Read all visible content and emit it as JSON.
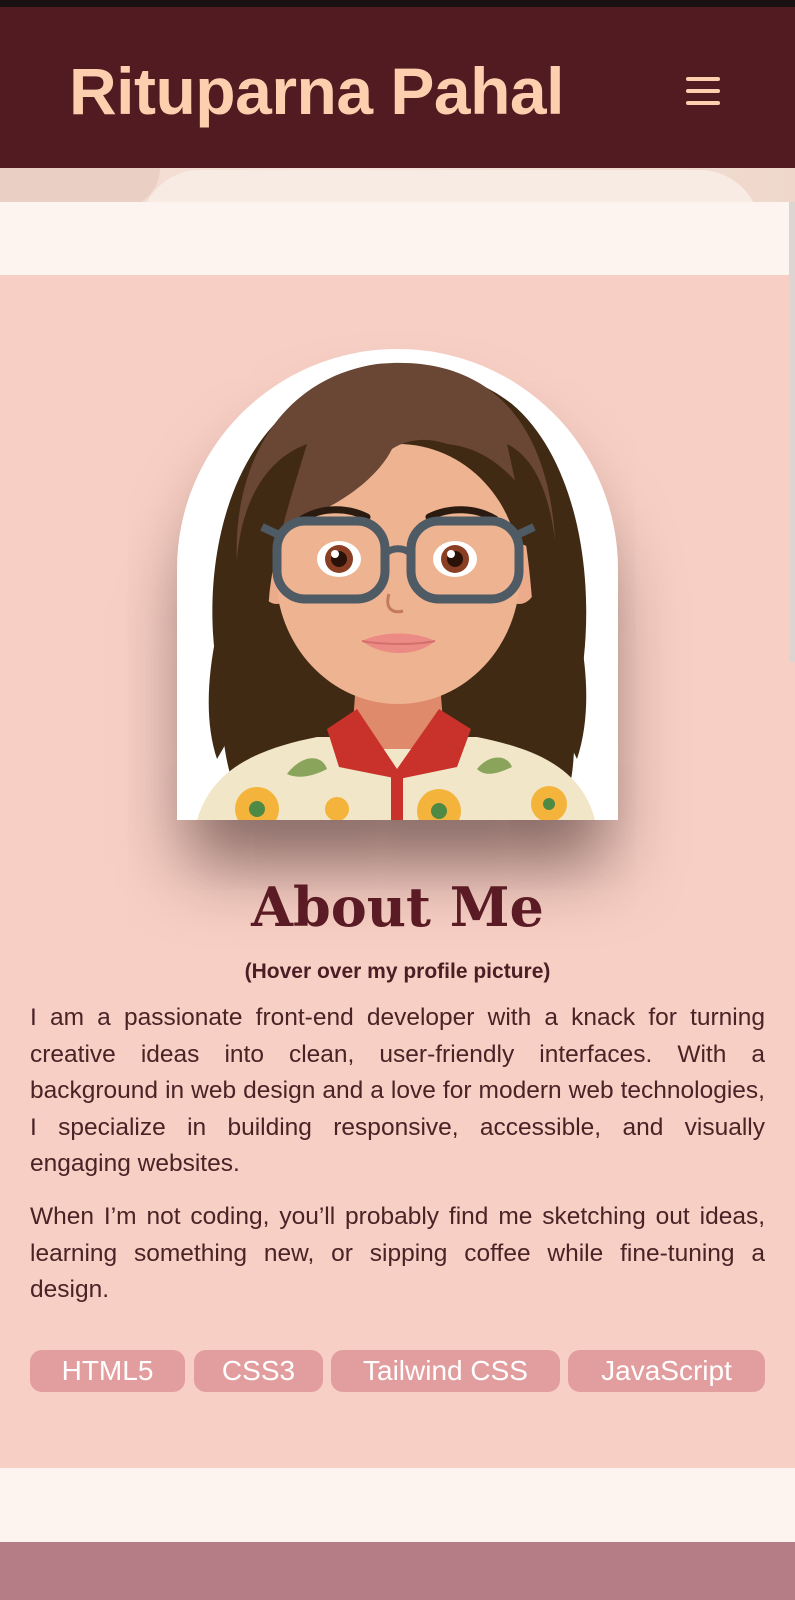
{
  "header": {
    "site_title": "Rituparna Pahal",
    "menu_icon": "hamburger-menu-icon",
    "background_color": "#521b21",
    "title_color": "#fdcfae"
  },
  "about": {
    "profile_image": "cartoon-avatar-woman-with-glasses",
    "title": "About Me",
    "hint": "(Hover over my profile picture)",
    "paragraphs": [
      "I am a passionate front-end developer with a knack for turning creative ideas into clean, user-friendly interfaces. With a background in web design and a love for modern web technologies, I specialize in building responsive, accessible, and visually engaging websites.",
      "When I’m not coding, you’ll probably find me sketching out ideas, learning something new, or sipping coffee while fine-tuning a design."
    ],
    "skills": [
      "HTML5",
      "CSS3",
      "Tailwind CSS",
      "JavaScript"
    ],
    "background_color": "#f8cfc4",
    "tag_color": "#e29d9f"
  },
  "footer": {
    "background_color": "#b57e87"
  }
}
